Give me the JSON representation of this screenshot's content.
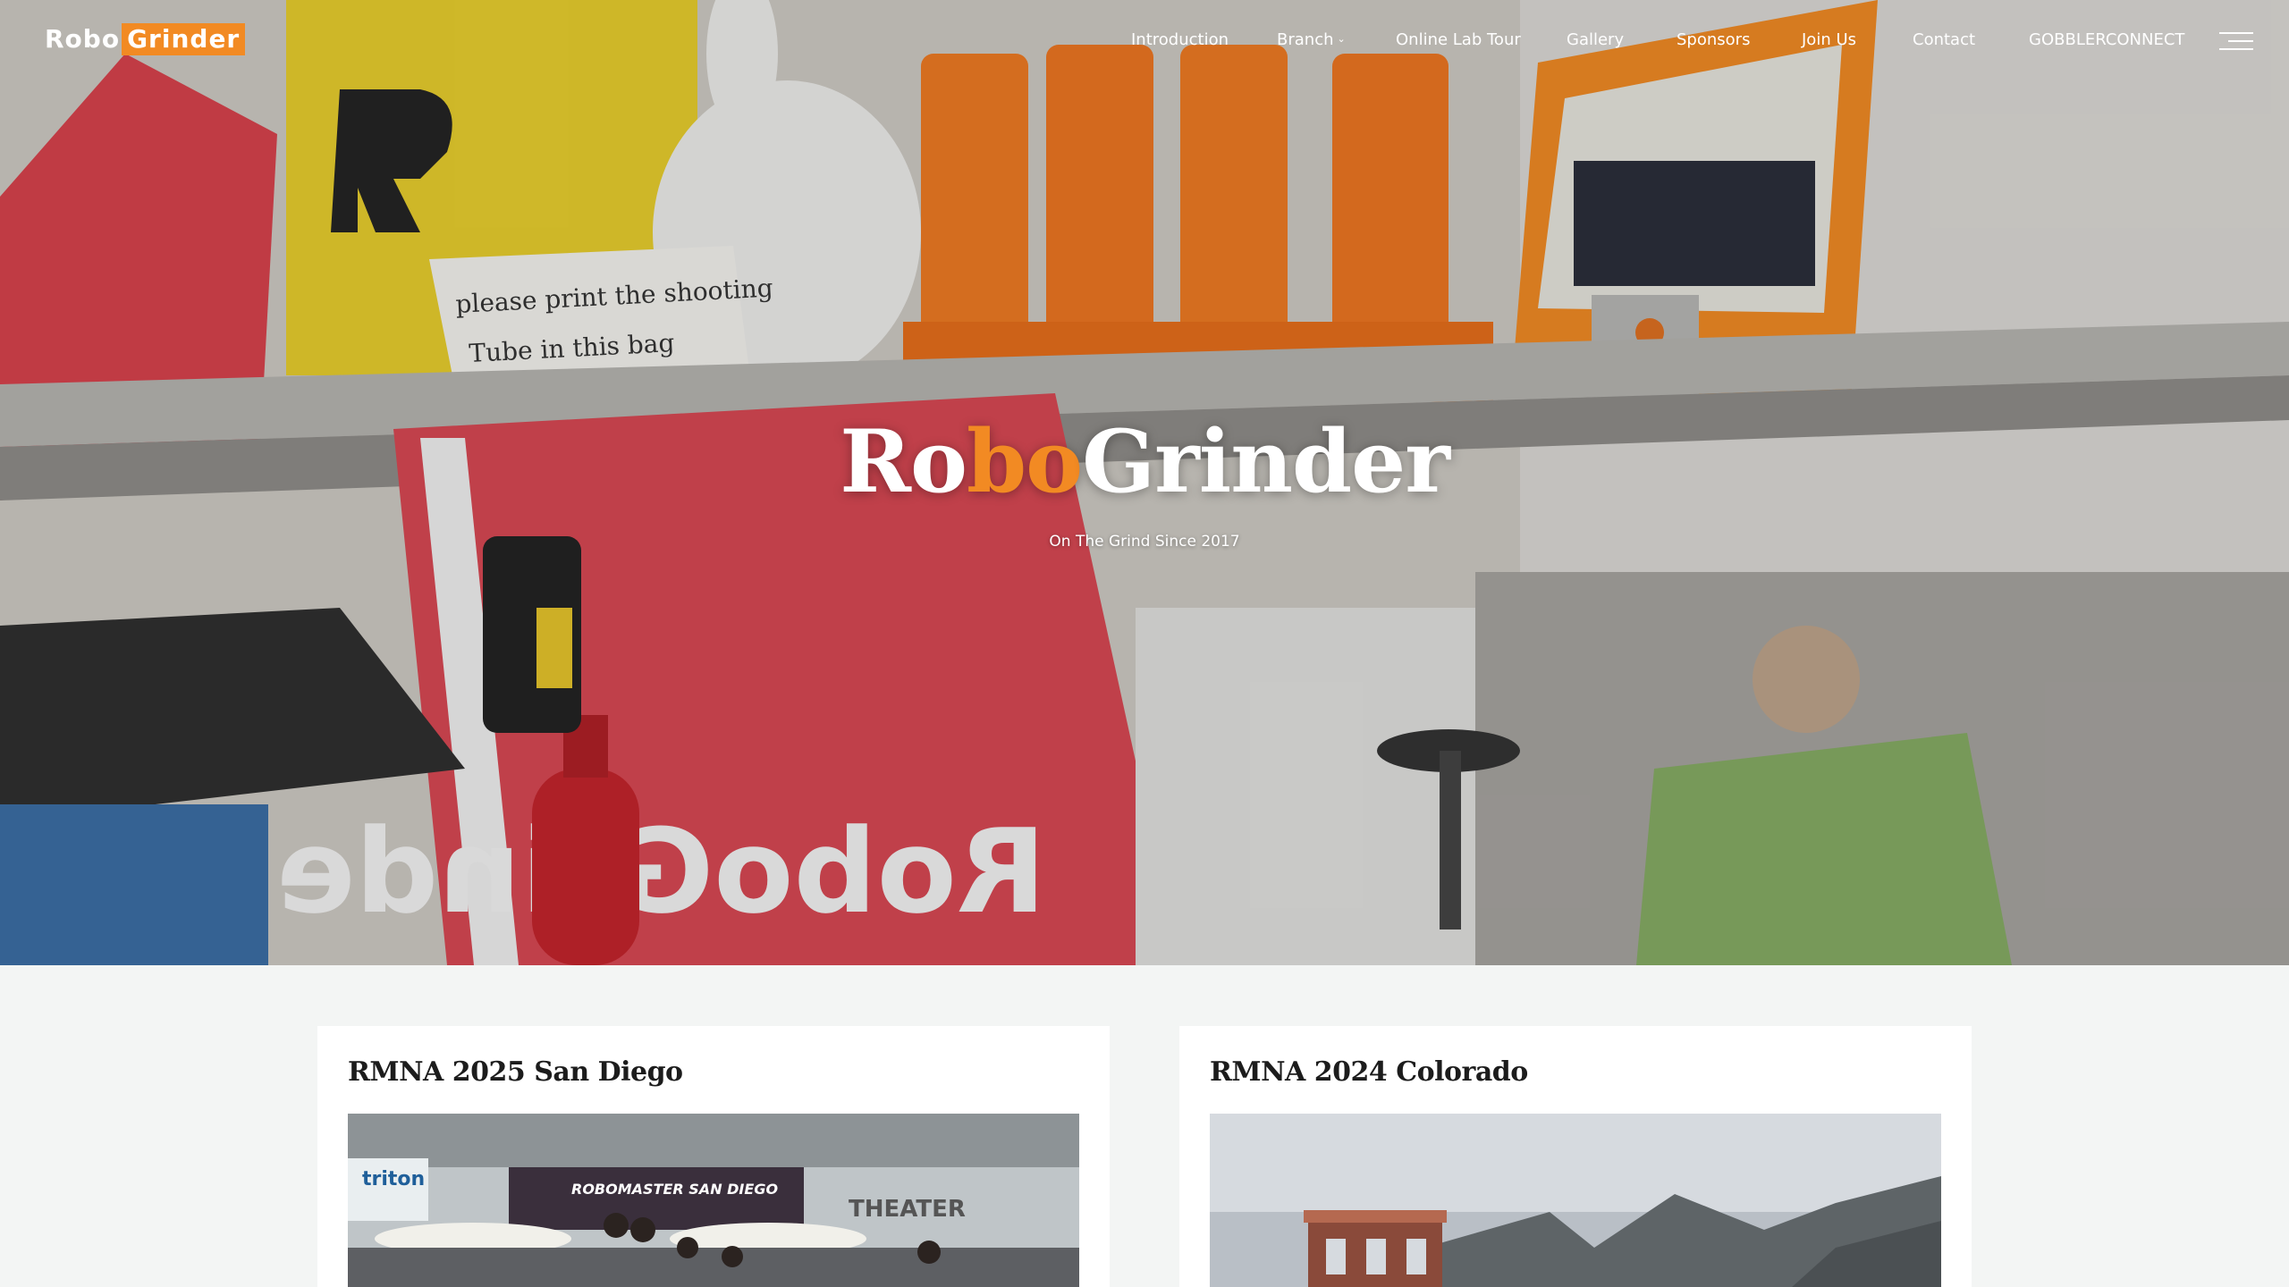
{
  "brand": {
    "logo_part1": "Robo",
    "logo_part2": "Grinder",
    "accent_color": "#f28a23"
  },
  "nav": {
    "items": [
      {
        "label": "Introduction"
      },
      {
        "label": "Branch",
        "has_dropdown": true
      },
      {
        "label": "Online Lab Tour"
      },
      {
        "label": "Gallery"
      },
      {
        "label": "Sponsors"
      },
      {
        "label": "Join Us"
      },
      {
        "label": "Contact"
      },
      {
        "label": "GOBBLERCONNECT"
      }
    ],
    "menu_icon": "hamburger-menu-icon"
  },
  "hero": {
    "title_part1": "Ro",
    "title_part2": "bo",
    "title_part3": "Grinder",
    "subtitle": "On The Grind Since 2017",
    "sign_note_line1": "please print the shooting",
    "sign_note_line2": "Tube in this bag",
    "banner_text": "RoboGrinder"
  },
  "cards": [
    {
      "title": "RMNA 2025 San Diego",
      "photo_sign": "ROBOMASTER SAN DIEGO",
      "photo_logo": "triton",
      "photo_building": "THEATER"
    },
    {
      "title": "RMNA 2024 Colorado"
    }
  ]
}
